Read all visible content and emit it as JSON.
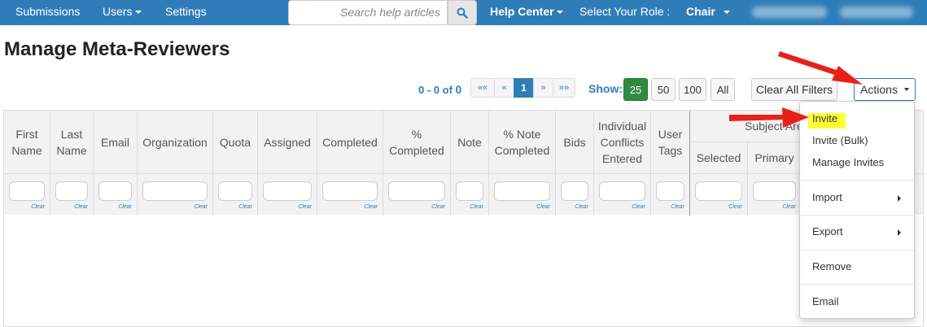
{
  "nav": {
    "submissions": "Submissions",
    "users": "Users",
    "settings": "Settings",
    "search_placeholder": "Search help articles",
    "help_center": "Help Center",
    "role_label": "Select Your Role :",
    "role_value": "Chair"
  },
  "page": {
    "title": "Manage Meta-Reviewers"
  },
  "pagination": {
    "range_prefix": "0 - 0 of ",
    "total": "0",
    "first": "««",
    "prev": "«",
    "current": "1",
    "next": "»",
    "last": "»»"
  },
  "page_size": {
    "label": "Show:",
    "options": [
      "25",
      "50",
      "100",
      "All"
    ],
    "selected": "25"
  },
  "toolbar": {
    "clear_filters": "Clear All Filters",
    "actions": "Actions"
  },
  "table": {
    "columns": [
      "First Name",
      "Last Name",
      "Email",
      "Organization",
      "Quota",
      "Assigned",
      "Completed",
      "% Completed",
      "Note",
      "% Note Completed",
      "Bids",
      "Individual Conflicts Entered",
      "User Tags"
    ],
    "group_header": "Subject Area",
    "group_subcolumns": [
      "Selected",
      "Primary"
    ],
    "filter_clear_label": "Clear"
  },
  "actions_menu": {
    "items": [
      "Invite",
      "Invite (Bulk)",
      "Manage Invites",
      "Import",
      "Export",
      "Remove",
      "Email"
    ],
    "highlighted": "Invite"
  },
  "colors": {
    "navbar": "#2f7db8",
    "accent": "#2f7db8",
    "active_size": "#2e8b3f",
    "annotation_arrow": "#e8201a",
    "highlight": "#ffff33"
  }
}
